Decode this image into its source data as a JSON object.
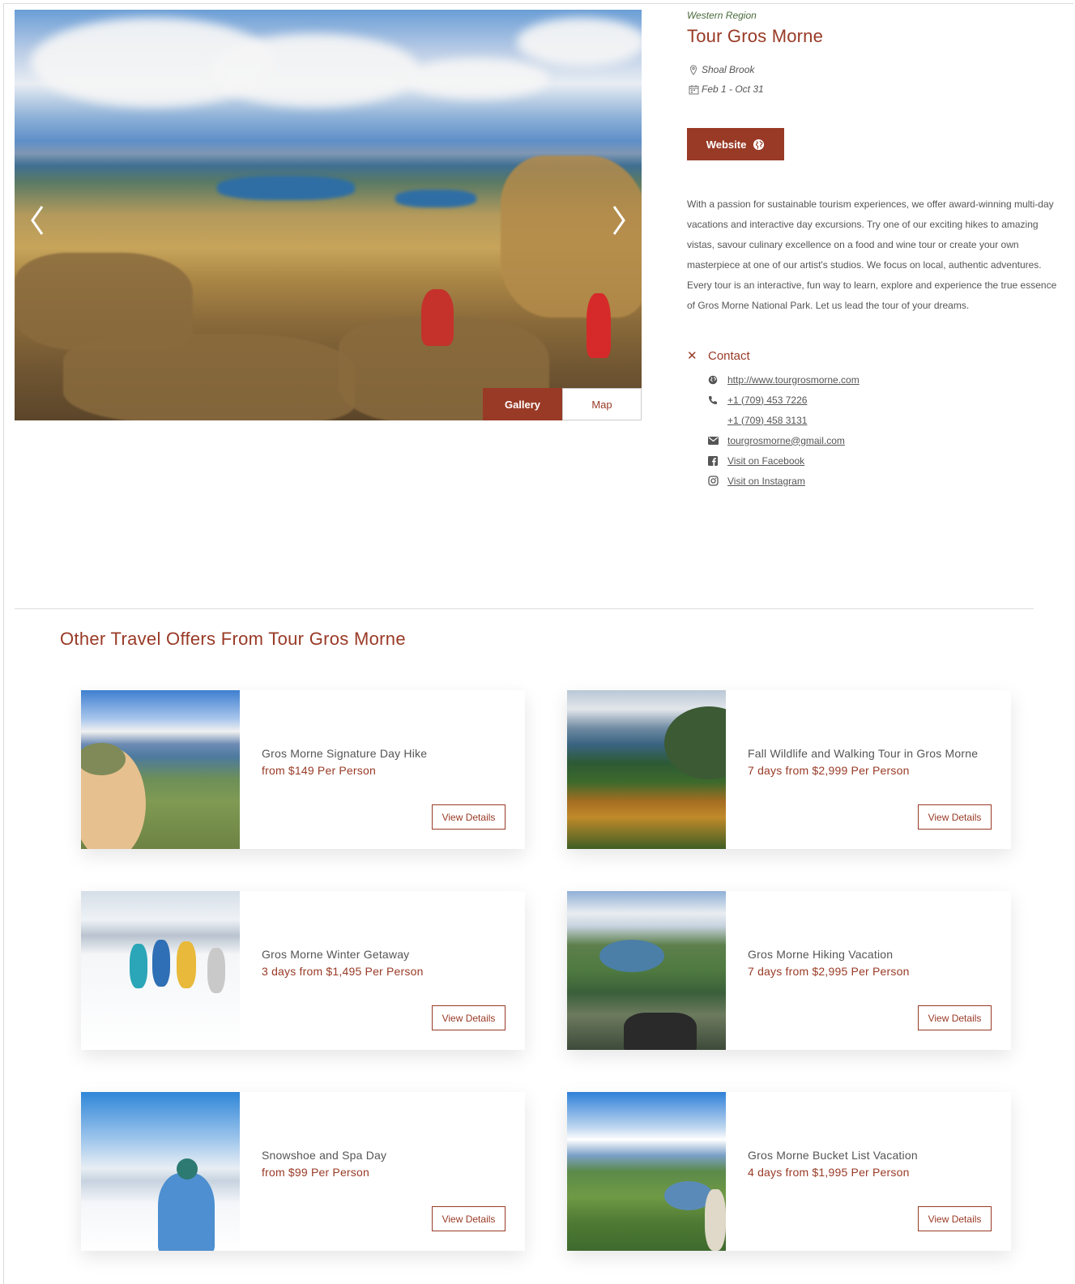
{
  "hero": {
    "image_alt": "Hikers on a rocky summit overlooking a valley and lake in Gros Morne",
    "prev_icon": "chevron-left-icon",
    "next_icon": "chevron-right-icon",
    "tabs": [
      {
        "label": "Gallery",
        "active": true
      },
      {
        "label": "Map",
        "active": false
      }
    ]
  },
  "listing": {
    "region": "Western Region",
    "title": "Tour Gros Morne",
    "location": "Shoal Brook",
    "dates": "Feb 1 - Oct 31",
    "website_label": "Website",
    "description": "With a passion for sustainable tourism experiences, we offer award-winning multi-day vacations and interactive day excursions. Try one of our exciting hikes to amazing vistas, savour culinary excellence on a food and wine tour or create your own masterpiece at one of our artist's studios. We focus on local, authentic adventures. Every tour is an interactive, fun way to learn, explore and experience the true essence of Gros Morne National Park. Let us lead the tour of your dreams."
  },
  "contact": {
    "heading": "Contact",
    "website": "http://www.tourgrosmorne.com",
    "phone1": "+1 (709) 453 7226",
    "phone2": "+1 (709) 458 3131",
    "email": "tourgrosmorne@gmail.com",
    "facebook": "Visit on Facebook",
    "instagram": "Visit on Instagram"
  },
  "offers": {
    "heading": "Other Travel Offers From Tour Gros Morne",
    "button_label": "View Details",
    "items": [
      {
        "name": "Gros Morne Signature Day Hike",
        "price": "from $149 Per Person"
      },
      {
        "name": "Fall Wildlife and Walking Tour in Gros Morne",
        "price": "7 days from $2,999 Per Person"
      },
      {
        "name": "Gros Morne Winter Getaway",
        "price": "3 days from $1,495 Per Person"
      },
      {
        "name": "Gros Morne Hiking Vacation",
        "price": "7 days from $2,995 Per Person"
      },
      {
        "name": "Snowshoe and Spa Day",
        "price": "from $99 Per Person"
      },
      {
        "name": "Gros Morne Bucket List Vacation",
        "price": "4 days from $1,995 Per Person"
      }
    ]
  },
  "colors": {
    "accent": "#993a26",
    "region_green": "#4a6a3c",
    "text": "#555555"
  }
}
